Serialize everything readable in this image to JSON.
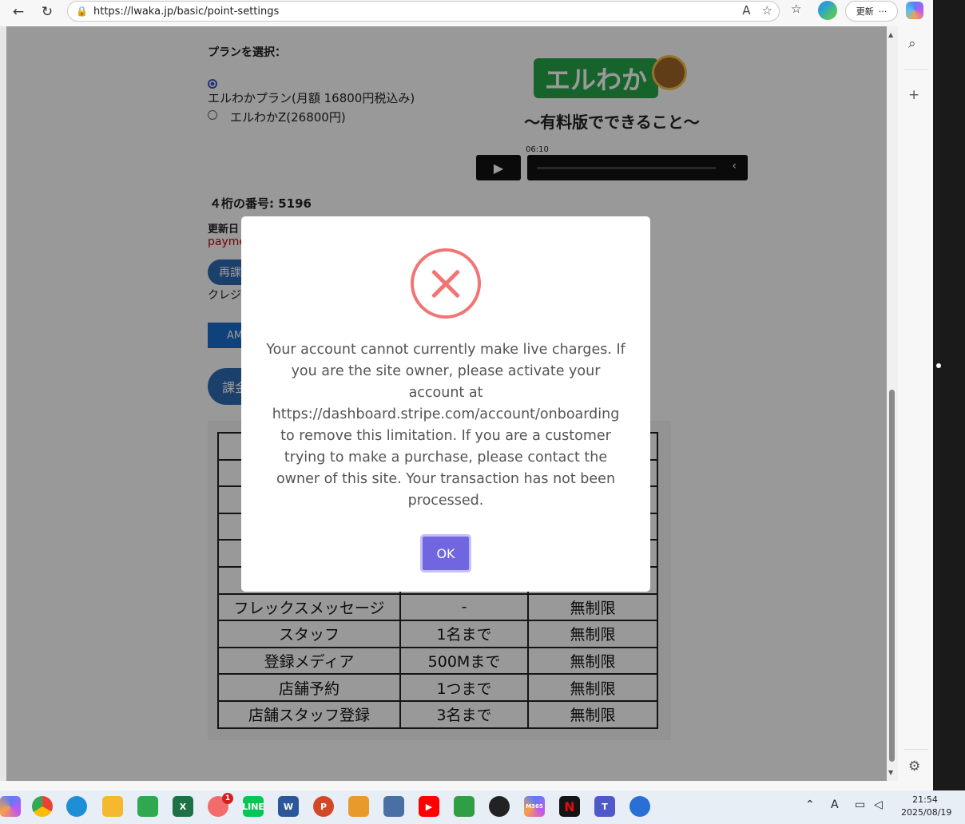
{
  "browser": {
    "url": "https://lwaka.jp/basic/point-settings",
    "update_label": "更新",
    "more_label": "···"
  },
  "page": {
    "plan_label": "プランを選択：",
    "plans": [
      {
        "label": "エルわかプラン(月額 16800円税込み)",
        "selected": true
      },
      {
        "label": "エルわかZ(26800円)",
        "selected": false
      }
    ],
    "video": {
      "logo_text": "エルわか",
      "title": "～有料版でできること～",
      "time": "06:10"
    },
    "number_label": "４桁の番号: 5196",
    "update_label": "更新日",
    "payment_text": "payme",
    "rebill_button": "再課",
    "credit_text": "クレジ",
    "amex_text": "AM",
    "charge_button": "課金",
    "table_rows": [
      {
        "c1": "フレックスメッセージ",
        "c2": "-",
        "c3": "無制限"
      },
      {
        "c1": "スタッフ",
        "c2": "1名まで",
        "c3": "無制限"
      },
      {
        "c1": "登録メディア",
        "c2": "500Mまで",
        "c3": "無制限"
      },
      {
        "c1": "店舗予約",
        "c2": "1つまで",
        "c3": "無制限"
      },
      {
        "c1": "店舗スタッフ登録",
        "c2": "3名まで",
        "c3": "無制限"
      }
    ]
  },
  "modal": {
    "message": "Your account cannot currently make live charges. If you are the site owner, please activate your account at https://dashboard.stripe.com/account/onboarding to remove this limitation. If you are a customer trying to make a purchase, please contact the owner of this site. Your transaction has not been processed.",
    "ok_label": "OK"
  },
  "taskbar": {
    "badge_count": "1",
    "time": "21:54",
    "date": "2025/08/19",
    "m365_label": "M365"
  }
}
